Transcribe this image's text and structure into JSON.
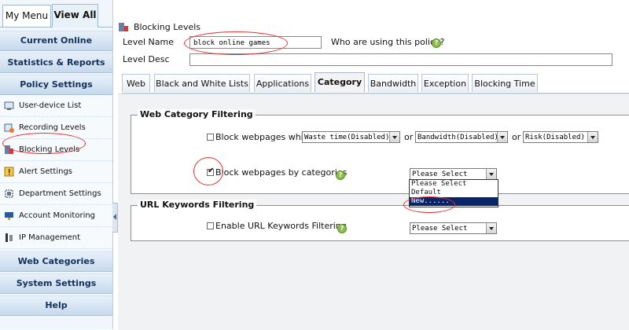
{
  "sidebar": {
    "tabs": [
      {
        "label": "My Menu"
      },
      {
        "label": "View All"
      }
    ],
    "sections": {
      "current_online": "Current Online",
      "statistics_reports": "Statistics & Reports",
      "policy_settings": "Policy Settings",
      "web_categories": "Web Categories",
      "system_settings": "System Settings",
      "help": "Help"
    },
    "items": [
      {
        "label": "User-device List",
        "icon": "user-device-list-icon"
      },
      {
        "label": "Recording Levels",
        "icon": "recording-levels-icon"
      },
      {
        "label": "Blocking Levels",
        "icon": "blocking-levels-icon"
      },
      {
        "label": "Alert Settings",
        "icon": "alert-settings-icon"
      },
      {
        "label": "Department Settings",
        "icon": "department-settings-icon"
      },
      {
        "label": "Account Monitoring",
        "icon": "account-monitoring-icon"
      },
      {
        "label": "IP Management",
        "icon": "ip-management-icon"
      }
    ]
  },
  "main": {
    "title": "Blocking Levels",
    "level_name_label": "Level Name",
    "level_name_value": "block online games",
    "who_using_label": "Who are using this policy?",
    "level_desc_label": "Level Desc",
    "level_desc_value": "",
    "tabs": [
      {
        "label": "Web"
      },
      {
        "label": "Black and White Lists"
      },
      {
        "label": "Applications"
      },
      {
        "label": "Category"
      },
      {
        "label": "Bandwidth"
      },
      {
        "label": "Exception"
      },
      {
        "label": "Blocking Time"
      }
    ],
    "active_tab": "Category",
    "web_category_filtering": {
      "legend": "Web Category Filtering",
      "block_which_label": "Block webpages which",
      "block_which_checked": false,
      "selects": [
        "Waste time(Disabled)",
        "Bandwidth(Disabled)",
        "Risk(Disabled)"
      ],
      "or_label": "or",
      "block_by_categories_label": "Block webpages by categories",
      "block_by_categories_checked": true,
      "category_select_value": "Please Select",
      "dropdown_options": [
        "Please Select",
        "Default",
        "New......"
      ],
      "dropdown_highlighted": "New......"
    },
    "url_keywords_filtering": {
      "legend": "URL Keywords Filtering",
      "enable_label": "Enable URL Keywords Filtering",
      "enable_checked": false,
      "select_value": "Please Select"
    }
  },
  "colors": {
    "sidebar_bg": "#f0f6fb",
    "section_header_text": "#12305a",
    "dropdown_highlight": "#0a246a",
    "annotation_red": "#e53030",
    "help_icon_green": "#8bbf4a"
  }
}
